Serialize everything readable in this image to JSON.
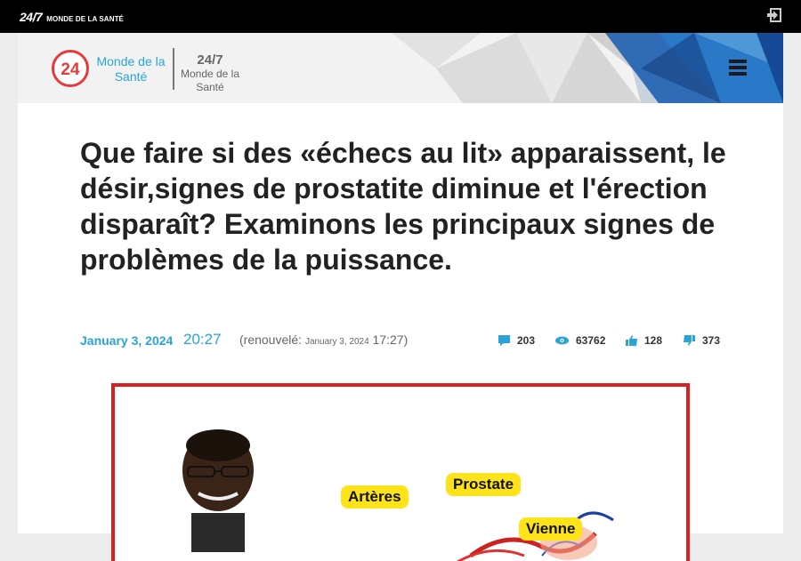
{
  "topbar": {
    "brand_number": "24/7",
    "brand_name": "MONDE DE LA SANTÉ",
    "login_icon": "login-icon"
  },
  "header": {
    "logo_number": "24",
    "logo_line1": "Monde de la",
    "logo_line2": "Santé",
    "logo2_line1": "24/7",
    "logo2_line2": "Monde de la",
    "logo2_line3": "Santé",
    "menu_icon": "hamburger-menu-icon",
    "colors": {
      "accent_red": "#e83a3a",
      "accent_blue": "#2aa3d8",
      "banner_blue": "#1f5fb0"
    }
  },
  "article": {
    "title": "Que faire si des «échecs au lit» apparaissent, le désir,signes de prostatite diminue et l'érection disparaît? Examinons les principaux signes de problèmes de la puissance.",
    "date": "January 3, 2024",
    "time": "20:27",
    "renewed_prefix": "(renouvelé:",
    "renewed_date": "January 3, 2024",
    "renewed_time": "17:27)",
    "stats": {
      "comments": "203",
      "views": "63762",
      "likes": "128",
      "dislikes": "373"
    }
  },
  "image": {
    "labels": {
      "arteries": "Artères",
      "prostate": "Prostate",
      "vein": "Vienne"
    },
    "border_color": "#d92020"
  }
}
